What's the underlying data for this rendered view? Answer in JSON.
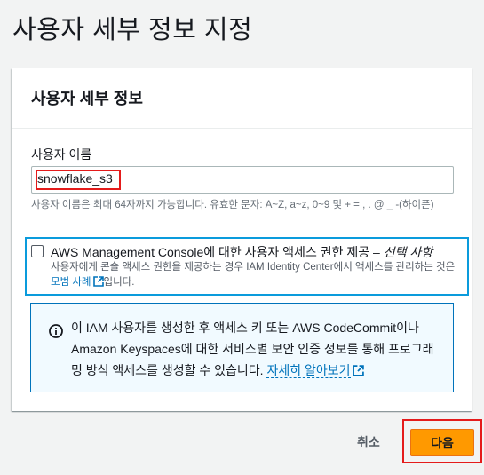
{
  "page": {
    "title": "사용자 세부 정보 지정"
  },
  "panel": {
    "title": "사용자 세부 정보",
    "username": {
      "label": "사용자 이름",
      "value": "snowflake_s3",
      "hint": "사용자 이름은 최대 64자까지 가능합니다. 유효한 문자: A~Z, a~z, 0~9 및 + = , . @ _ -(하이픈)"
    },
    "console_access": {
      "label": "AWS Management Console에 대한 사용자 액세스 권한 제공 –",
      "optional": "선택 사항",
      "checked": false,
      "desc_prefix": "사용자에게 콘솔 액세스 권한을 제공하는 경우 IAM Identity Center에서 액세스를 관리하는 것은",
      "desc_link": "모범 사례",
      "desc_suffix": "입니다."
    },
    "info": {
      "text": "이 IAM 사용자를 생성한 후 액세스 키 또는 AWS CodeCommit이나 Amazon Keyspaces에 대한 서비스별 보안 인증 정보를 통해 프로그래밍 방식 액세스를 생성할 수 있습니다.",
      "link": "자세히 알아보기"
    }
  },
  "footer": {
    "cancel_label": "취소",
    "next_label": "다음"
  },
  "colors": {
    "accent": "#ff9900",
    "link": "#0073bb",
    "highlight_red": "#e41b1b",
    "highlight_blue": "#0a9bdc"
  }
}
